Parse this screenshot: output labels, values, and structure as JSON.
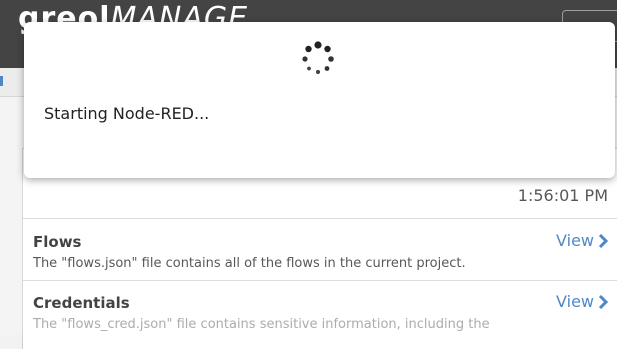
{
  "app": {
    "logo_bold": "greol",
    "logo_thin": "MANAGE"
  },
  "modal": {
    "message": "Starting Node-RED...",
    "spinner_icon": "loading-spinner-icon"
  },
  "panel": {
    "timestamp": "1:56:01 PM",
    "items": [
      {
        "title": "Flows",
        "description": "The \"flows.json\" file contains all of the flows in the current project.",
        "view_label": "View"
      },
      {
        "title": "Credentials",
        "description": "The \"flows_cred.json\" file contains sensitive information, including the",
        "view_label": "View"
      }
    ]
  },
  "colors": {
    "link": "#2a6ebb",
    "header": "#1b1b1b"
  }
}
